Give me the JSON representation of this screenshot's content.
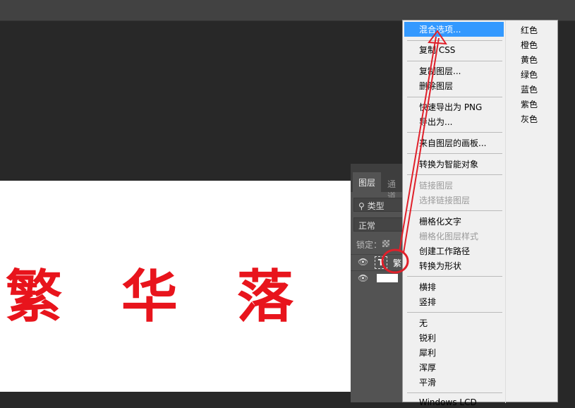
{
  "canvas": {
    "text": "繁 华 落 日",
    "text_color": "#e8141c"
  },
  "layers_panel": {
    "tabs": [
      "图层",
      "通道"
    ],
    "filter": "类型",
    "blend_mode": "正常",
    "lock_label": "锁定：",
    "layers": [
      {
        "type_icon": "T",
        "name": "繁"
      },
      {
        "type": "fill"
      }
    ]
  },
  "context_menu": {
    "items": [
      {
        "label": "混合选项...",
        "selected": true
      },
      {
        "label": "复制 CSS"
      },
      {
        "label": "复制图层..."
      },
      {
        "label": "删除图层"
      },
      {
        "label": "快速导出为 PNG"
      },
      {
        "label": "导出为..."
      },
      {
        "label": "来自图层的画板..."
      },
      {
        "label": "转换为智能对象"
      },
      {
        "label": "链接图层",
        "disabled": true
      },
      {
        "label": "选择链接图层",
        "disabled": true
      },
      {
        "label": "栅格化文字"
      },
      {
        "label": "栅格化图层样式",
        "disabled": true
      },
      {
        "label": "创建工作路径"
      },
      {
        "label": "转换为形状"
      },
      {
        "label": "横排"
      },
      {
        "label": "竖排"
      },
      {
        "label": "无"
      },
      {
        "label": "锐利"
      },
      {
        "label": "犀利"
      },
      {
        "label": "浑厚"
      },
      {
        "label": "平滑"
      },
      {
        "label": "Windows LCD"
      }
    ],
    "colors": [
      "红色",
      "橙色",
      "黄色",
      "绿色",
      "蓝色",
      "紫色",
      "灰色"
    ]
  },
  "accent": "#3399ff"
}
